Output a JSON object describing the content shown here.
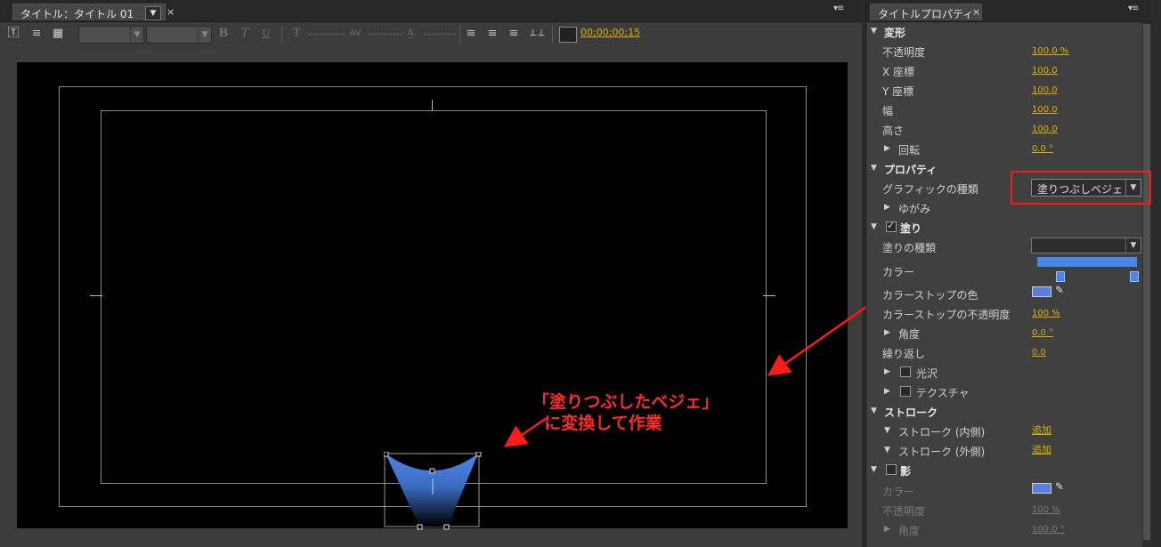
{
  "colors": {
    "accent_value": "#e0b000",
    "annotation": "#ff2a2a",
    "fill_color": "#4a86e8"
  },
  "left_panel": {
    "tab_label": "タイトル：タイトル 01",
    "tab_close": "×",
    "menu_icon": "▾≡",
    "toolbar": {
      "bold": "B",
      "italic": "T",
      "underline": "U",
      "kerning": "AV",
      "timecode": "00;00;00;15"
    }
  },
  "annotation": "「塗りつぶしたベジェ」\n  に変換して作業",
  "right_panel": {
    "tab_label": "タイトルプロパティ",
    "tab_close": "×",
    "menu_icon": "▾≡",
    "transform": {
      "header": "変形",
      "opacity_label": "不透明度",
      "opacity_value": "100.0 %",
      "x_label": "X 座標",
      "x_value": "100.0",
      "y_label": "Y 座標",
      "y_value": "100.0",
      "width_label": "幅",
      "width_value": "100.0",
      "height_label": "高さ",
      "height_value": "100.0",
      "rotation_label": "回転",
      "rotation_value": "0.0 °"
    },
    "properties": {
      "header": "プロパティ",
      "graphic_type_label": "グラフィックの種類",
      "graphic_type_value": "塗りつぶしベジェ",
      "distort_label": "ゆがみ"
    },
    "fill": {
      "header": "塗り",
      "fill_type_label": "塗りの種類",
      "color_label": "カラー",
      "stop_color_label": "カラーストップの色",
      "stop_opacity_label": "カラーストップの不透明度",
      "stop_opacity_value": "100 %",
      "angle_label": "角度",
      "angle_value": "0.0 °",
      "repeat_label": "繰り返し",
      "repeat_value": "0.0",
      "sheen_label": "光沢",
      "texture_label": "テクスチャ"
    },
    "stroke": {
      "header": "ストローク",
      "inner_label": "ストローク (内側)",
      "inner_action": "追加",
      "outer_label": "ストローク (外側)",
      "outer_action": "追加"
    },
    "shadow": {
      "header": "影",
      "color_label": "カラー",
      "opacity_label": "不透明度",
      "opacity_value": "100 %",
      "angle_label": "角度",
      "angle_value": "100.0 °"
    }
  }
}
